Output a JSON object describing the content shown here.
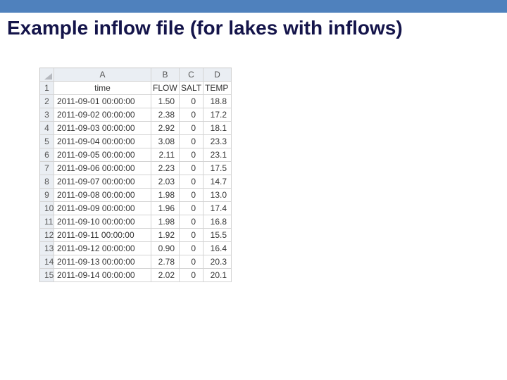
{
  "title": "Example inflow file (for lakes with inflows)",
  "sheet": {
    "columns": [
      "A",
      "B",
      "C",
      "D"
    ],
    "headers": {
      "time": "time",
      "flow": "FLOW",
      "salt": "SALT",
      "temp": "TEMP"
    },
    "rows": [
      {
        "n": "1"
      },
      {
        "n": "2",
        "time": "2011-09-01 00:00:00",
        "flow": "1.50",
        "salt": "0",
        "temp": "18.8"
      },
      {
        "n": "3",
        "time": "2011-09-02 00:00:00",
        "flow": "2.38",
        "salt": "0",
        "temp": "17.2"
      },
      {
        "n": "4",
        "time": "2011-09-03 00:00:00",
        "flow": "2.92",
        "salt": "0",
        "temp": "18.1"
      },
      {
        "n": "5",
        "time": "2011-09-04 00:00:00",
        "flow": "3.08",
        "salt": "0",
        "temp": "23.3"
      },
      {
        "n": "6",
        "time": "2011-09-05 00:00:00",
        "flow": "2.11",
        "salt": "0",
        "temp": "23.1"
      },
      {
        "n": "7",
        "time": "2011-09-06 00:00:00",
        "flow": "2.23",
        "salt": "0",
        "temp": "17.5"
      },
      {
        "n": "8",
        "time": "2011-09-07 00:00:00",
        "flow": "2.03",
        "salt": "0",
        "temp": "14.7"
      },
      {
        "n": "9",
        "time": "2011-09-08 00:00:00",
        "flow": "1.98",
        "salt": "0",
        "temp": "13.0"
      },
      {
        "n": "10",
        "time": "2011-09-09 00:00:00",
        "flow": "1.96",
        "salt": "0",
        "temp": "17.4"
      },
      {
        "n": "11",
        "time": "2011-09-10 00:00:00",
        "flow": "1.98",
        "salt": "0",
        "temp": "16.8"
      },
      {
        "n": "12",
        "time": "2011-09-11 00:00:00",
        "flow": "1.92",
        "salt": "0",
        "temp": "15.5"
      },
      {
        "n": "13",
        "time": "2011-09-12 00:00:00",
        "flow": "0.90",
        "salt": "0",
        "temp": "16.4"
      },
      {
        "n": "14",
        "time": "2011-09-13 00:00:00",
        "flow": "2.78",
        "salt": "0",
        "temp": "20.3"
      },
      {
        "n": "15",
        "time": "2011-09-14 00:00:00",
        "flow": "2.02",
        "salt": "0",
        "temp": "20.1"
      }
    ]
  }
}
